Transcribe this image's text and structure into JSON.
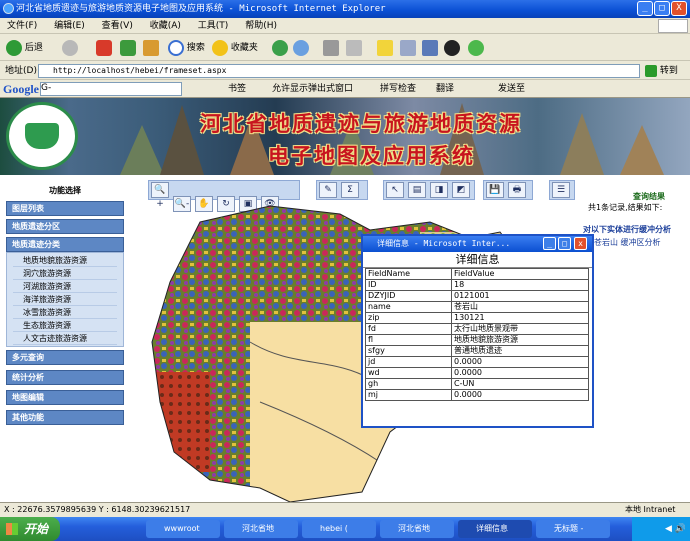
{
  "window": {
    "title": "河北省地质遗迹与旅游地质资源电子地图及应用系统 - Microsoft Internet Explorer",
    "minimize": "_",
    "maximize": "□",
    "close": "X"
  },
  "menu": [
    "文件(F)",
    "编辑(E)",
    "查看(V)",
    "收藏(A)",
    "工具(T)",
    "帮助(H)"
  ],
  "toolbar": {
    "back": "后退",
    "search": "搜索",
    "favorites": "收藏夹"
  },
  "address": {
    "label": "地址(D)",
    "url": "http://localhost/hebei/frameset.aspx",
    "go": "转到"
  },
  "googlebar": {
    "logo": "Google",
    "search_placeholder": "G-",
    "bookmarks": "书签",
    "popup_allowed": "允许显示弹出式窗口",
    "spell_check": "拼写检查",
    "translate": "翻译",
    "send_to": "发送至"
  },
  "banner": {
    "title_line1": "河北省地质遗迹与旅游地质资源",
    "title_line2": "电子地图及应用系统"
  },
  "leftmenu": {
    "title": "功能选择",
    "sections": [
      {
        "label": "图层列表"
      },
      {
        "label": "地质遗迹分区"
      },
      {
        "label": "地质遗迹分类",
        "items": [
          "地质地貌旅游资源",
          "洞穴旅游资源",
          "河湖旅游资源",
          "海洋旅游资源",
          "冰雪旅游资源",
          "生态旅游资源",
          "人文古迹旅游资源"
        ]
      },
      {
        "label": "多元查询"
      },
      {
        "label": "统计分析"
      },
      {
        "label": "地图编辑"
      },
      {
        "label": "其他功能"
      }
    ]
  },
  "maptools": {
    "g1": [
      "🔍+",
      "🔍-",
      "✋",
      "↻",
      "▣",
      "👁"
    ],
    "g2": [
      "✎",
      "Σ"
    ],
    "g3": [
      "↖",
      "▤",
      "◨",
      "◩"
    ],
    "g4": [
      "💾",
      "🖶"
    ],
    "g5": [
      "☰"
    ]
  },
  "results": {
    "title": "查询结果",
    "summary": "共1条记录,结果如下:",
    "command": "对以下实体进行缓冲分析",
    "link": "苍岩山 缓冲区分析"
  },
  "popup": {
    "title": "详细信息 - Microsoft Inter...",
    "heading": "详细信息",
    "header": [
      "FieldName",
      "FieldValue"
    ],
    "rows": [
      [
        "ID",
        "18"
      ],
      [
        "DZYJID",
        "0121001"
      ],
      [
        "name",
        "苍岩山"
      ],
      [
        "zip",
        "130121"
      ],
      [
        "fd",
        "太行山地质景观带"
      ],
      [
        "fl",
        "地质地貌旅游资源"
      ],
      [
        "sfgy",
        "普通地质遗迹"
      ],
      [
        "jd",
        "0.0000"
      ],
      [
        "wd",
        "0.0000"
      ],
      [
        "gh",
        "C-UN"
      ],
      [
        "mj",
        "0.0000"
      ]
    ]
  },
  "status": {
    "coords": "X : 22676.3579895639 Y : 6148.30239621517",
    "zone": "本地 Intranet"
  },
  "taskbar": {
    "start": "开始",
    "tasks": [
      "wwwroot",
      "河北省地",
      "hebei (",
      "河北省地",
      "详细信息",
      "无标题 -"
    ],
    "clock": "◀ 🔊"
  },
  "colors": {
    "titlebar": "#0a4fd4",
    "panel": "#5d87c4",
    "banner_text": "#c8141e",
    "result_title": "#1a6a1a"
  }
}
